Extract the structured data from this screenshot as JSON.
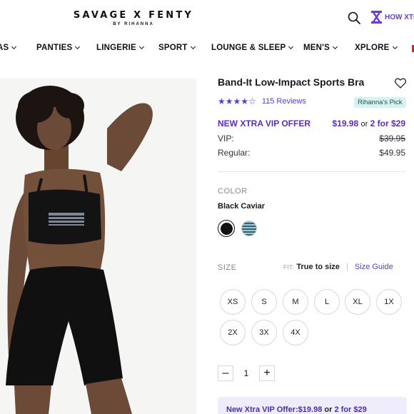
{
  "header": {
    "logo_main": "SAVAGE X FENTY",
    "logo_sub": "BY RIHANNA",
    "xtra_label": "HOW XTR"
  },
  "nav": {
    "items": [
      "AS",
      "PANTIES",
      "LINGERIE",
      "SPORT",
      "LOUNGE & SLEEP",
      "MEN'S",
      "XPLORE"
    ]
  },
  "product": {
    "title": "Band-It Low-Impact Sports Bra",
    "rating": 4,
    "reviews": "115 Reviews",
    "badge": "Rihanna's Pick",
    "vip_offer_label": "NEW XTRA VIP OFFER",
    "offer_price": "$19.98",
    "offer_or": "or",
    "offer_bundle": "2 for $29",
    "vip_label": "VIP:",
    "vip_price": "$39.95",
    "regular_label": "Regular:",
    "regular_price": "$49.95"
  },
  "color": {
    "label": "COLOR",
    "selected": "Black Caviar",
    "swatches": [
      "#111111",
      "#356373"
    ]
  },
  "size": {
    "label": "SIZE",
    "fit_key": "FIT:",
    "fit_value": "True to size",
    "guide": "Size Guide",
    "options": [
      "XS",
      "S",
      "M",
      "L",
      "XL",
      "1X",
      "2X",
      "3X",
      "4X"
    ]
  },
  "quantity": {
    "minus": "–",
    "value": "1",
    "plus": "+"
  },
  "promo": {
    "label": "New Xtra VIP Offer:",
    "price": "$19.98",
    "or": "or",
    "bundle": "2 for $29"
  }
}
